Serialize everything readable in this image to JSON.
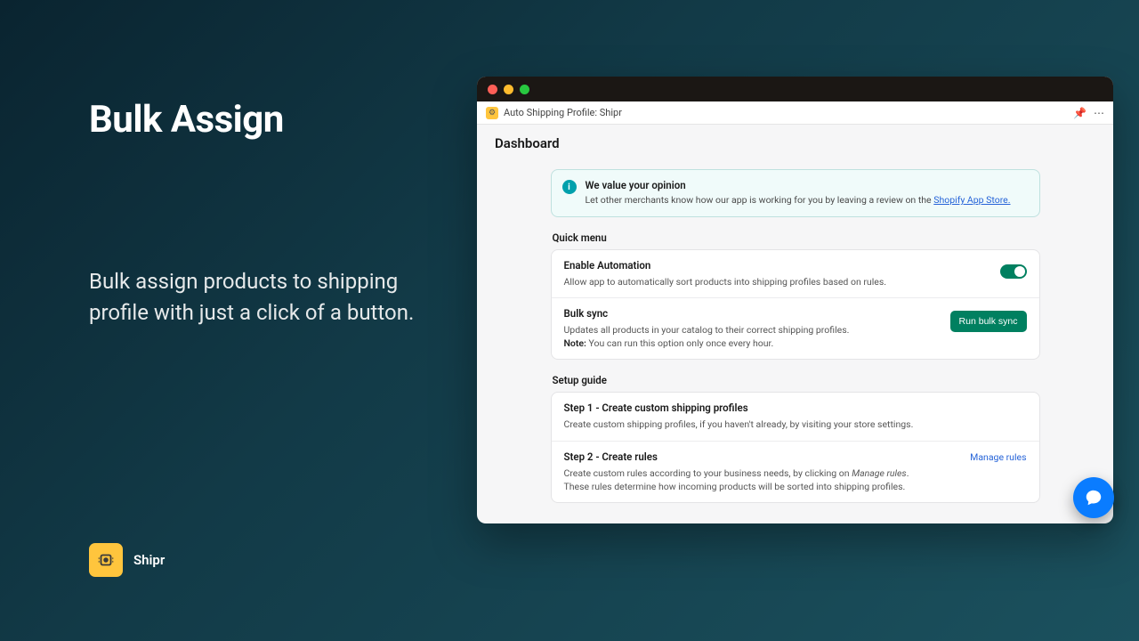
{
  "promo": {
    "heading": "Bulk Assign",
    "subheading": "Bulk assign products to shipping profile with just a click of a button."
  },
  "brand": {
    "name": "Shipr"
  },
  "appbar": {
    "title": "Auto Shipping Profile: Shipr"
  },
  "page": {
    "title": "Dashboard"
  },
  "banner": {
    "title": "We value your opinion",
    "body_prefix": "Let other merchants know how our app is working for you by leaving a review on the ",
    "link_text": "Shopify App Store."
  },
  "quickmenu": {
    "label": "Quick menu",
    "automation": {
      "title": "Enable Automation",
      "sub": "Allow app to automatically sort products into shipping profiles based on rules."
    },
    "bulksync": {
      "title": "Bulk sync",
      "sub": "Updates all products in your catalog to their correct shipping profiles.",
      "note_label": "Note:",
      "note_text": " You can run this option only once every hour.",
      "button": "Run bulk sync"
    }
  },
  "setup": {
    "label": "Setup guide",
    "step1": {
      "title": "Step 1 - Create custom shipping profiles",
      "sub": "Create custom shipping profiles, if you haven't already, by visiting your store settings."
    },
    "step2": {
      "title": "Step 2 - Create rules",
      "sub_a": "Create custom rules according to your business needs, by clicking on ",
      "sub_em": "Manage rules",
      "sub_b": ".",
      "sub2": "These rules determine how incoming products will be sorted into shipping profiles.",
      "link": "Manage rules"
    }
  }
}
